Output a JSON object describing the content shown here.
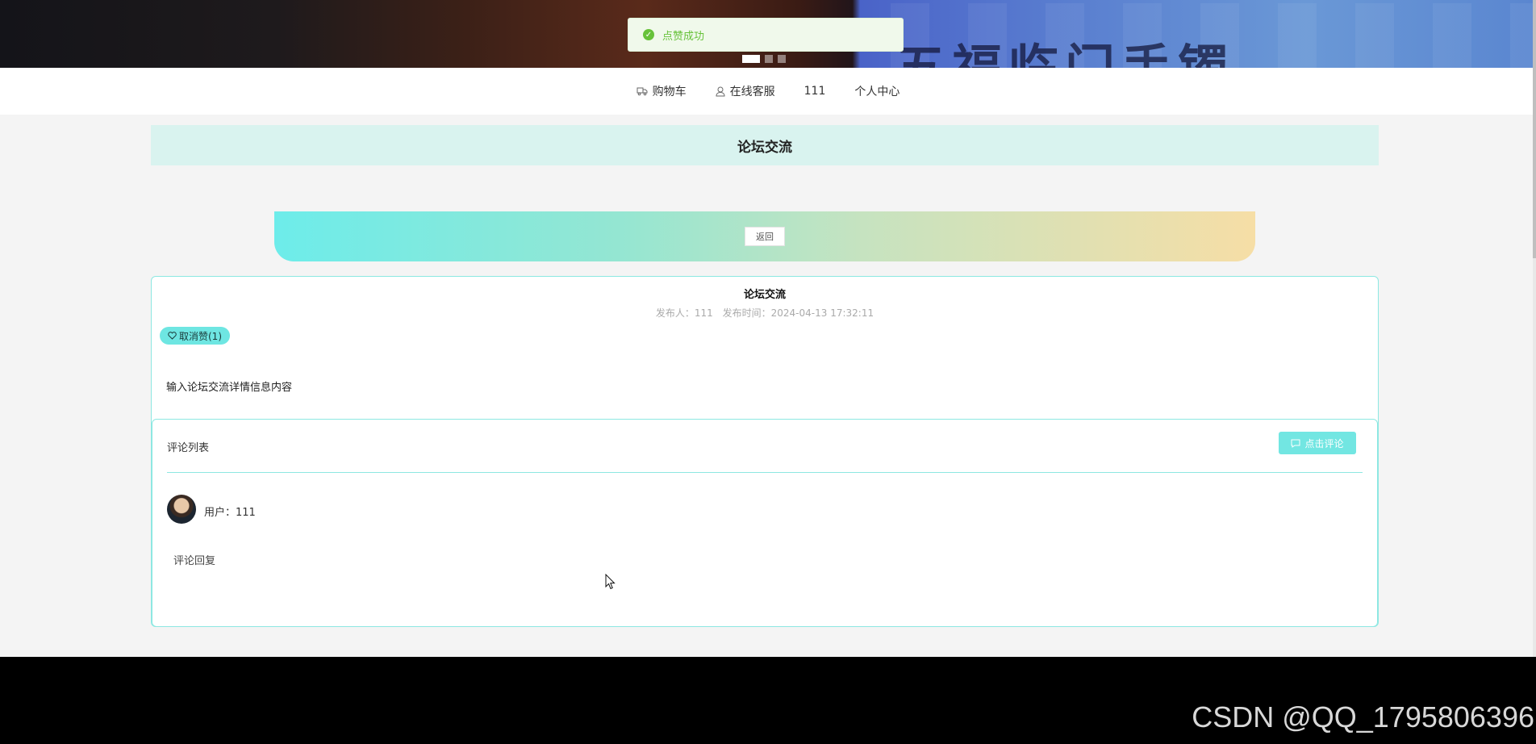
{
  "banner": {
    "title_text": "五福临门手镯",
    "carousel_dots": 3,
    "active_dot": 0
  },
  "toast": {
    "message": "点赞成功",
    "color": "#67c23a"
  },
  "nav": {
    "items": [
      {
        "label": "购物车",
        "icon": "cart-icon"
      },
      {
        "label": "在线客服",
        "icon": "user-icon"
      },
      {
        "label": "111",
        "icon": null
      },
      {
        "label": "个人中心",
        "icon": null
      }
    ]
  },
  "page": {
    "title": "论坛交流",
    "back_label": "返回"
  },
  "post": {
    "title": "论坛交流",
    "publisher_label": "发布人：111",
    "time_label": "发布时间：2024-04-13 17:32:11",
    "like_label": "取消赞(1)",
    "content": "输入论坛交流详情信息内容"
  },
  "comments": {
    "header": "评论列表",
    "add_label": "点击评论",
    "items": [
      {
        "user_label": "用户：111",
        "text": "评论回复"
      }
    ]
  },
  "watermark": "CSDN @QQ_1795806396",
  "colors": {
    "accent": "#6ee6e2",
    "border": "#8de8e2",
    "title_bg": "#d9f3ef"
  }
}
